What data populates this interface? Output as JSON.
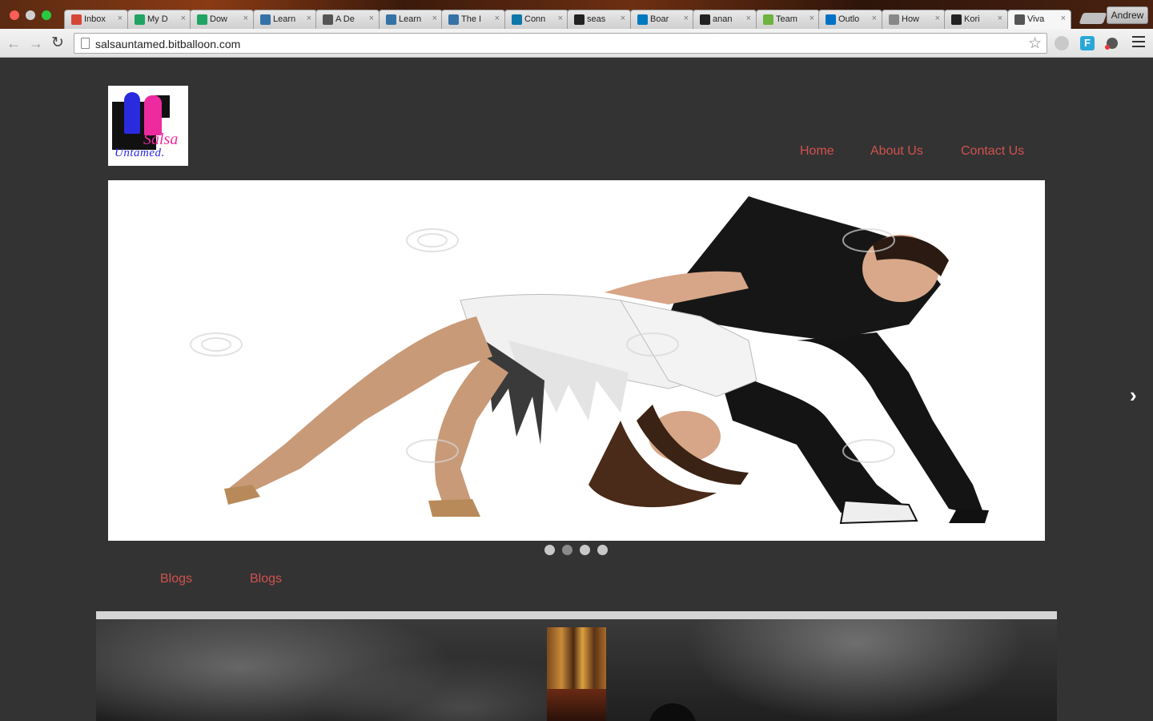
{
  "browser": {
    "tabs": [
      {
        "title": "Inbox",
        "favicon": "gmail-icon",
        "color": "#d44638"
      },
      {
        "title": "My D",
        "favicon": "google-drive-icon",
        "color": "#1fa463"
      },
      {
        "title": "Dow",
        "favicon": "google-drive-icon",
        "color": "#1fa463"
      },
      {
        "title": "Learn",
        "favicon": "python-icon",
        "color": "#3572a5"
      },
      {
        "title": "A De",
        "favicon": "page-icon",
        "color": "#555555"
      },
      {
        "title": "Learn",
        "favicon": "python-icon",
        "color": "#3572a5"
      },
      {
        "title": "The I",
        "favicon": "python-icon",
        "color": "#3572a5"
      },
      {
        "title": "Conn",
        "favicon": "linkedin-icon",
        "color": "#0e76a8"
      },
      {
        "title": "seas",
        "favicon": "github-icon",
        "color": "#222222"
      },
      {
        "title": "Boar",
        "favicon": "trello-icon",
        "color": "#0079bf"
      },
      {
        "title": "anan",
        "favicon": "github-icon",
        "color": "#222222"
      },
      {
        "title": "Team",
        "favicon": "mingle-icon",
        "color": "#6cb33f"
      },
      {
        "title": "Outlo",
        "favicon": "outlook-icon",
        "color": "#0072c6"
      },
      {
        "title": "How",
        "favicon": "apple-icon",
        "color": "#888888"
      },
      {
        "title": "Kori",
        "favicon": "github-icon",
        "color": "#222222"
      },
      {
        "title": "Viva",
        "favicon": "page-icon",
        "color": "#555555",
        "active": true
      }
    ],
    "profile_name": "Andrew",
    "url": "salsauntamed.bitballoon.com"
  },
  "site": {
    "logo": {
      "line1": "Salsa",
      "line2": "Untamed."
    },
    "nav": {
      "home": "Home",
      "about": "About Us",
      "contact": "Contact Us"
    },
    "slider": {
      "next_arrow": "›",
      "dots": [
        {
          "active": false
        },
        {
          "active": true
        },
        {
          "active": false
        },
        {
          "active": false
        }
      ]
    },
    "blogs": [
      "Blogs",
      "Blogs"
    ]
  },
  "colors": {
    "page_background": "#333333",
    "link": "#d1524f"
  }
}
